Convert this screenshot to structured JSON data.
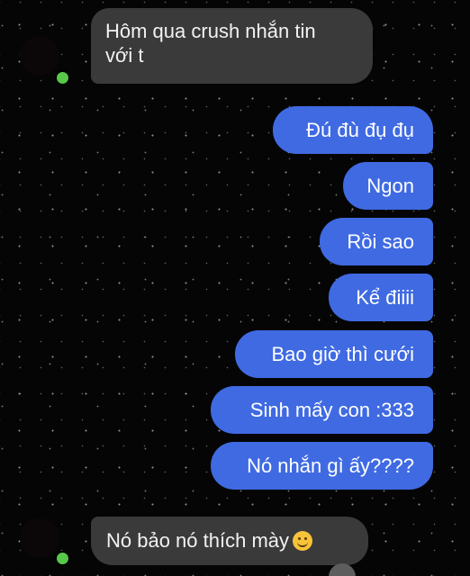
{
  "conversation": {
    "messages": [
      {
        "sender": "other",
        "text_lines": [
          "Hôm qua crush nhắn tin",
          "với t"
        ]
      },
      {
        "sender": "me",
        "text": "Đú đù đụ đụ"
      },
      {
        "sender": "me",
        "text": "Ngon"
      },
      {
        "sender": "me",
        "text": "Rồi sao"
      },
      {
        "sender": "me",
        "text": "Kể điiii"
      },
      {
        "sender": "me",
        "text": "Bao giờ thì cưới"
      },
      {
        "sender": "me",
        "text": "Sinh mấy con :333"
      },
      {
        "sender": "me",
        "text": "Nó nhắn gì ấy????"
      },
      {
        "sender": "other",
        "text": "Nó bảo nó thích mày",
        "emoji": "smiling-face-emoji"
      }
    ]
  },
  "colors": {
    "background": "#000000",
    "incoming_bubble": "#3a3a3a",
    "outgoing_bubble": "#3f6ae2",
    "online_indicator": "#57c84a"
  }
}
